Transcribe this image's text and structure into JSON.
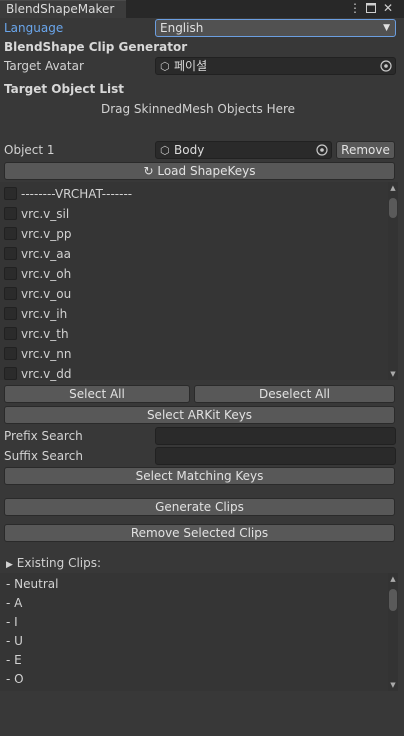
{
  "window": {
    "tab_title": "BlendShapeMaker",
    "menu_icon": "kebab-menu-icon",
    "maximize_icon": "maximize-icon",
    "close_icon": "close-icon"
  },
  "language": {
    "label": "Language",
    "value": "English"
  },
  "section_title": "BlendShape Clip Generator",
  "target_avatar": {
    "label": "Target Avatar",
    "value": "페이셜"
  },
  "target_object_list": {
    "title": "Target Object List",
    "drop_hint": "Drag SkinnedMesh Objects Here"
  },
  "object1": {
    "label": "Object 1",
    "value": "Body",
    "remove_label": "Remove"
  },
  "load_shapekeys_label": "Load ShapeKeys",
  "shape_keys": [
    "--------VRCHAT-------",
    "vrc.v_sil",
    "vrc.v_pp",
    "vrc.v_aa",
    "vrc.v_oh",
    "vrc.v_ou",
    "vrc.v_ih",
    "vrc.v_th",
    "vrc.v_nn",
    "vrc.v_dd"
  ],
  "buttons": {
    "select_all": "Select All",
    "deselect_all": "Deselect All",
    "select_arkit": "Select ARKit Keys",
    "select_matching": "Select Matching Keys",
    "generate_clips": "Generate Clips",
    "remove_selected_clips": "Remove Selected Clips"
  },
  "prefix_search": {
    "label": "Prefix Search",
    "value": ""
  },
  "suffix_search": {
    "label": "Suffix Search",
    "value": ""
  },
  "existing_clips": {
    "title": "Existing Clips:",
    "items": [
      "- Neutral",
      "- A",
      "- I",
      "- U",
      "- E",
      "- O"
    ]
  },
  "colors": {
    "background": "#383838",
    "accent": "#6aa6ec",
    "button": "#585858",
    "field": "#2a2a2a"
  }
}
